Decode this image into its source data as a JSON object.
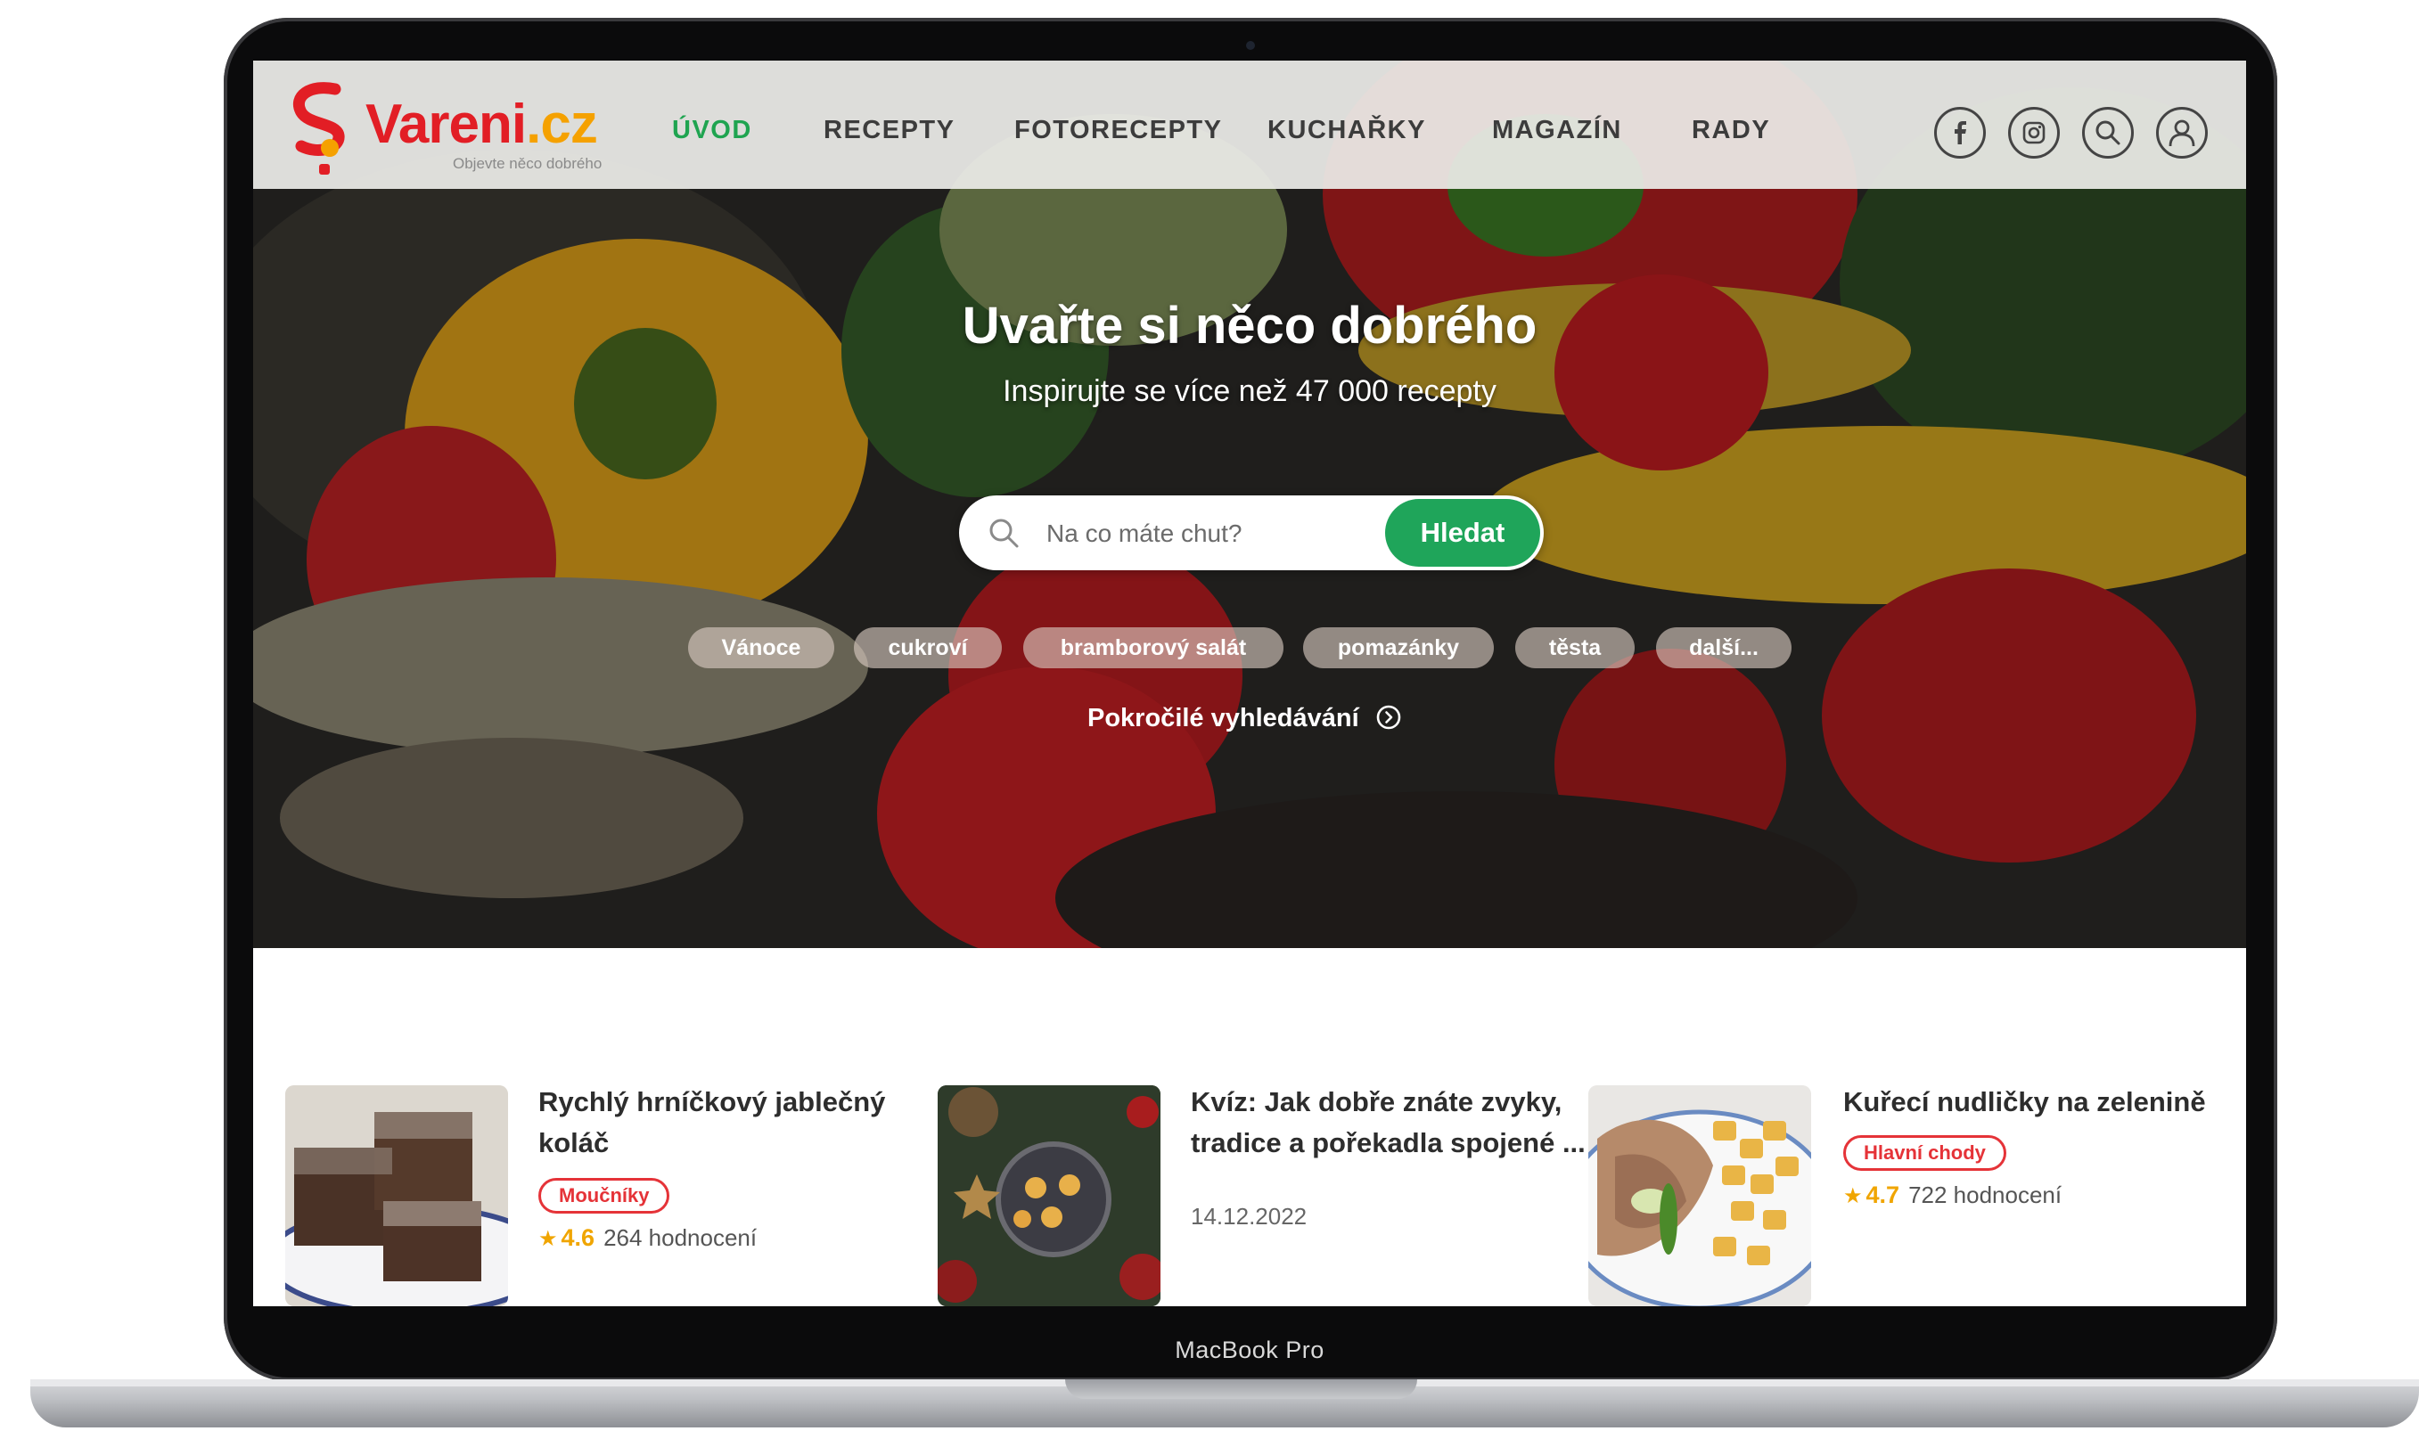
{
  "device": {
    "label": "MacBook Pro"
  },
  "brand": {
    "name_main": "Vareni",
    "name_tld": ".cz",
    "tagline": "Objevte něco dobrého"
  },
  "nav": {
    "items": [
      {
        "label": "ÚVOD",
        "active": true
      },
      {
        "label": "RECEPTY",
        "active": false
      },
      {
        "label": "FOTORECEPTY",
        "active": false
      },
      {
        "label": "KUCHAŘKY",
        "active": false
      },
      {
        "label": "MAGAZÍN",
        "active": false
      },
      {
        "label": "RADY",
        "active": false
      }
    ],
    "icons": [
      "facebook-icon",
      "instagram-icon",
      "search-icon",
      "user-icon"
    ]
  },
  "hero": {
    "title": "Uvařte si něco dobrého",
    "subtitle": "Inspirujte se více než 47 000 recepty",
    "search_placeholder": "Na co máte chut?",
    "search_button": "Hledat",
    "tags": [
      "Vánoce",
      "cukroví",
      "bramborový salát",
      "pomazánky",
      "těsta",
      "další..."
    ],
    "advanced_link": "Pokročilé vyhledávání"
  },
  "cards": [
    {
      "title_line1": "Rychlý hrníčkový jablečný",
      "title_line2": "koláč",
      "badge": "Moučníky",
      "rating": "4.6",
      "rating_count": "264 hodnocení"
    },
    {
      "title_line1": "Kvíz: Jak dobře znáte zvyky,",
      "title_line2": "tradice a pořekadla spojené ...",
      "date": "14.12.2022"
    },
    {
      "title_line1": "Kuřecí nudličky na zelenině",
      "badge": "Hlavní chody",
      "rating": "4.7",
      "rating_count": "722 hodnocení"
    }
  ],
  "colors": {
    "brand_red": "#e21e25",
    "brand_orange": "#f5a100",
    "accent_green": "#1fa55a",
    "badge_red": "#e53338",
    "star": "#f0a500"
  }
}
